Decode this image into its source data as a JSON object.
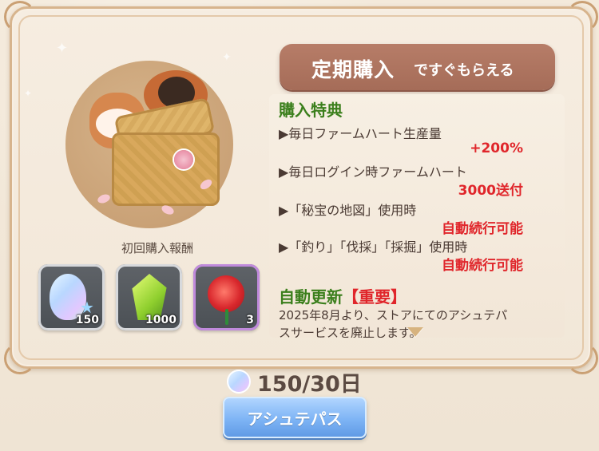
{
  "banner": {
    "title_main": "定期購入",
    "title_sub": "ですぐもらえる"
  },
  "left": {
    "first_purchase_reward_label": "初回購入報酬",
    "items": [
      {
        "name": "shell",
        "count": "150"
      },
      {
        "name": "green-gem",
        "count": "1000"
      },
      {
        "name": "red-rose",
        "count": "3"
      }
    ]
  },
  "benefits": {
    "title": "購入特典",
    "entries": [
      {
        "label": "▶毎日ファームハート生産量",
        "value": "+200%"
      },
      {
        "label": "▶毎日ログイン時ファームハート",
        "value": "3000送付"
      },
      {
        "label": "▶「秘宝の地図」使用時",
        "value": "自動続行可能"
      },
      {
        "label": "▶「釣り」「伐採」「採掘」使用時",
        "value": "自動続行可能"
      }
    ]
  },
  "auto_renew": {
    "title": "自動更新",
    "important": "【重要】",
    "text_line1": "2025年8月より、ストアにてのアシュテパ",
    "text_line2": "スサービスを廃止します。"
  },
  "purchase": {
    "price": "150/30日",
    "button_label": "アシュテパス"
  }
}
